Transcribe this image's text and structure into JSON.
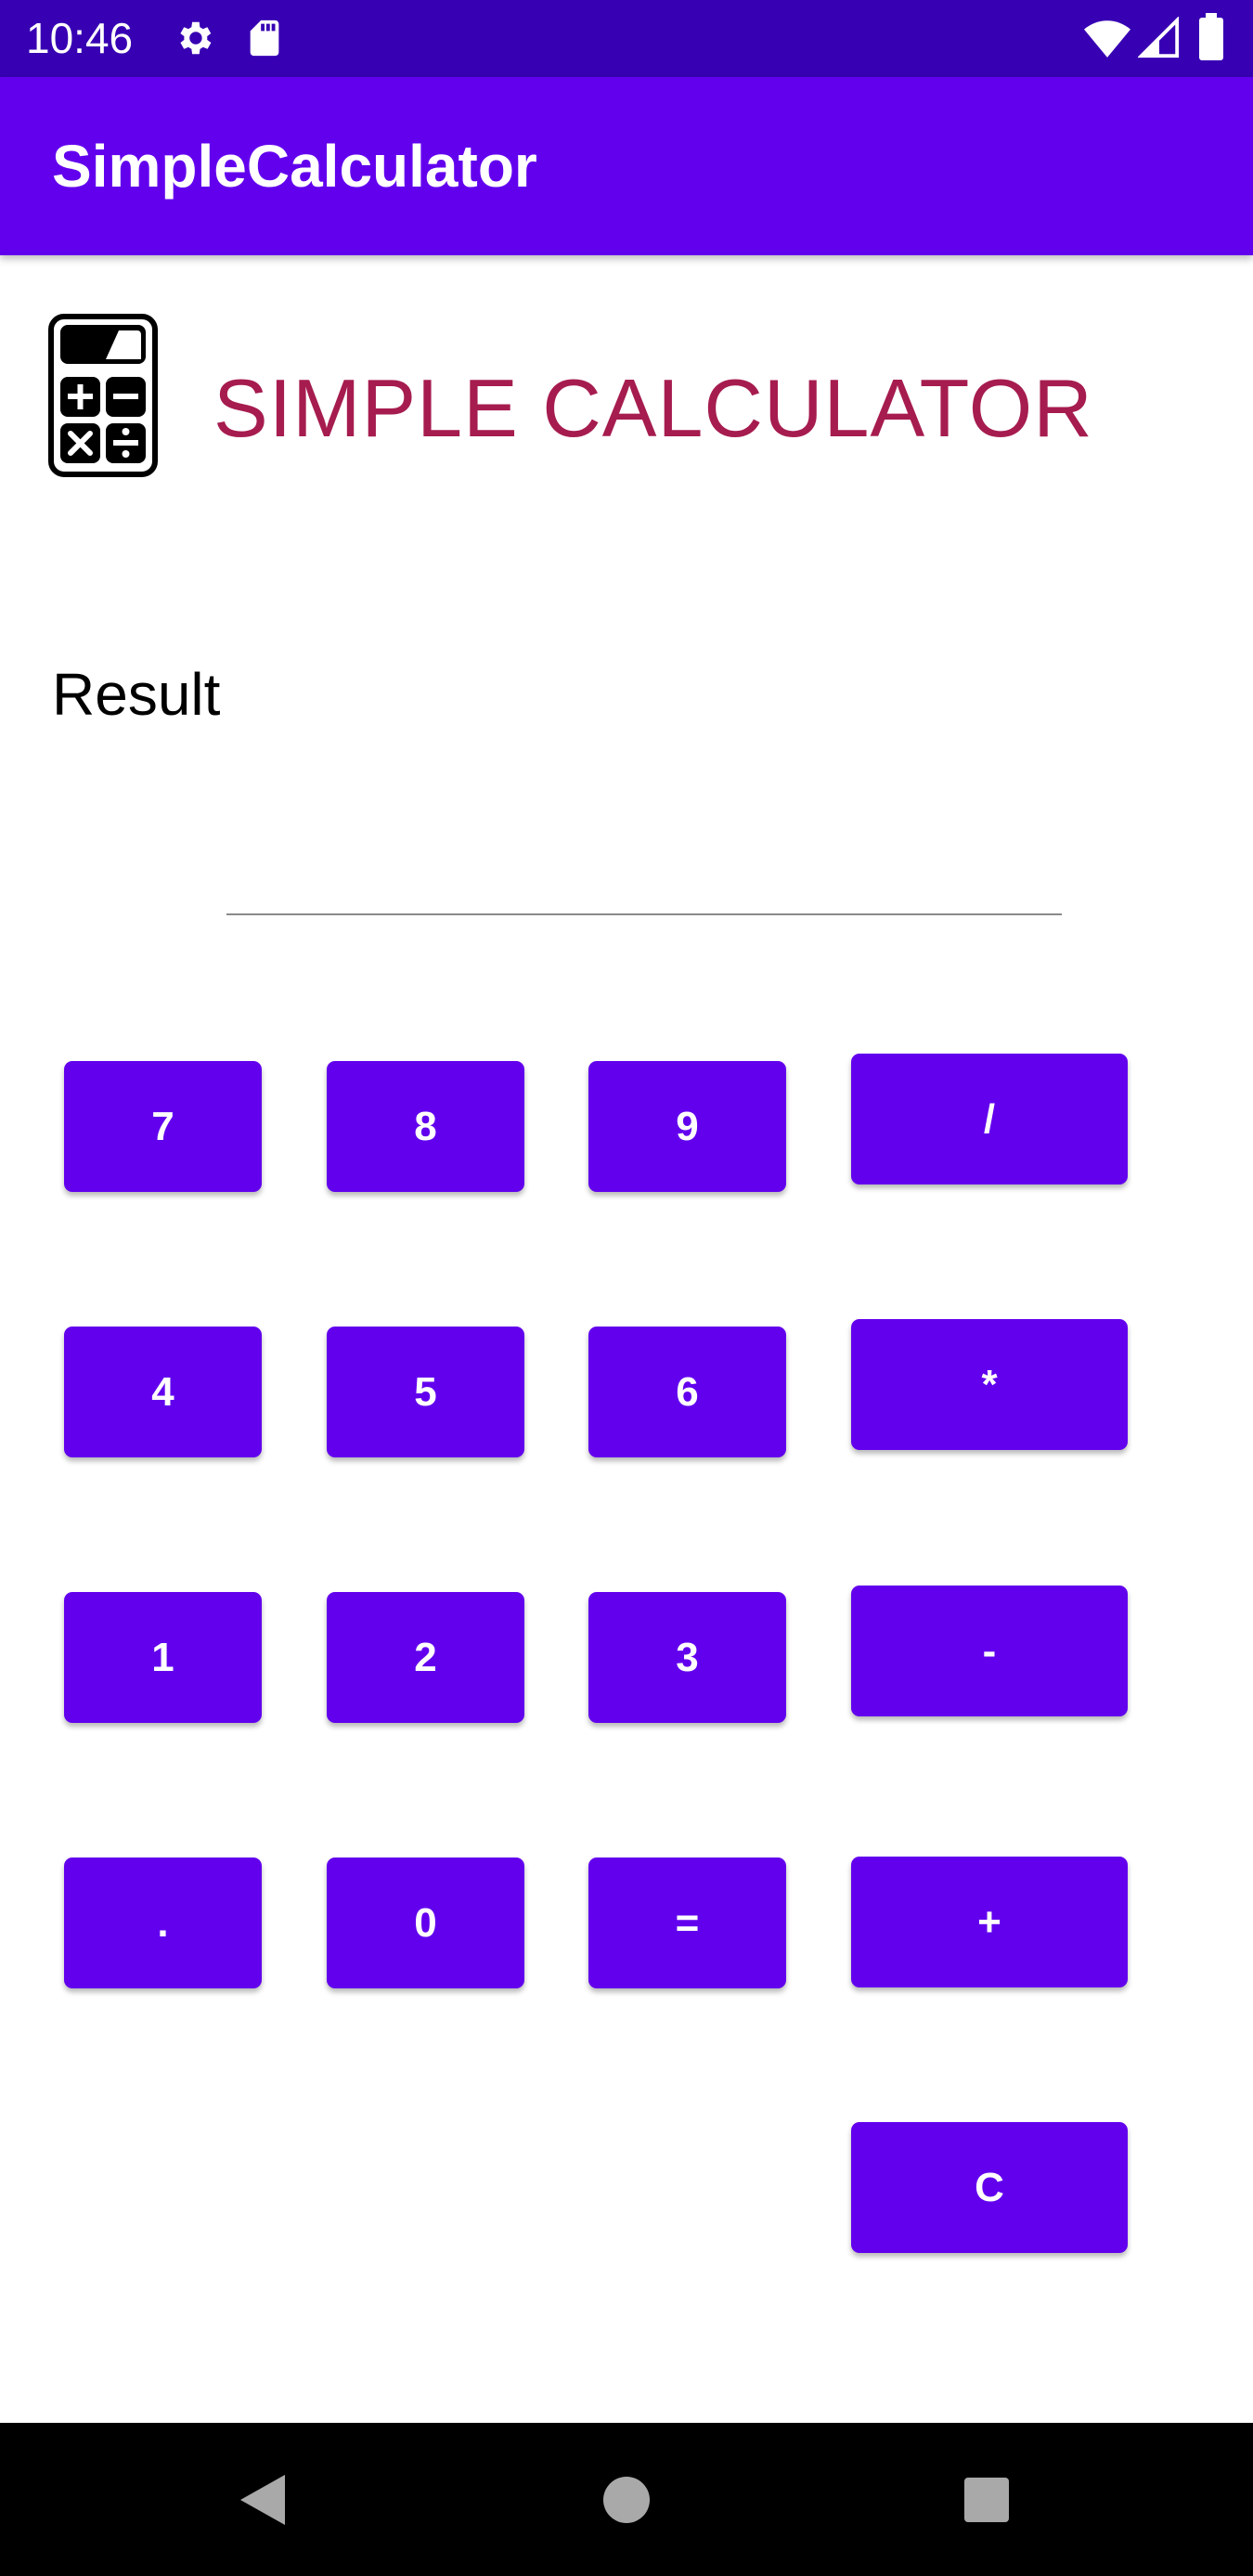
{
  "status_bar": {
    "time": "10:46",
    "icons": [
      "settings-icon",
      "sd-card-icon",
      "wifi-icon",
      "signal-icon",
      "battery-icon"
    ]
  },
  "app_bar": {
    "title": "SimpleCalculator"
  },
  "header": {
    "logo_icon": "calculator-icon",
    "title": "SIMPLE CALCULATOR"
  },
  "result": {
    "label": "Result",
    "value": "",
    "placeholder": ""
  },
  "keypad": {
    "seven": "7",
    "eight": "8",
    "nine": "9",
    "divide": "/",
    "four": "4",
    "five": "5",
    "six": "6",
    "multiply": "*",
    "one": "1",
    "two": "2",
    "three": "3",
    "minus": "-",
    "dot": ".",
    "zero": "0",
    "equals": "=",
    "plus": "+",
    "clear": "C"
  },
  "nav_bar": {
    "icons": [
      "back-icon",
      "home-icon",
      "recents-icon"
    ]
  },
  "colors": {
    "status_bar": "#3700b3",
    "primary": "#6200ee",
    "heading": "#a61c4f",
    "nav_bar": "#000000"
  }
}
